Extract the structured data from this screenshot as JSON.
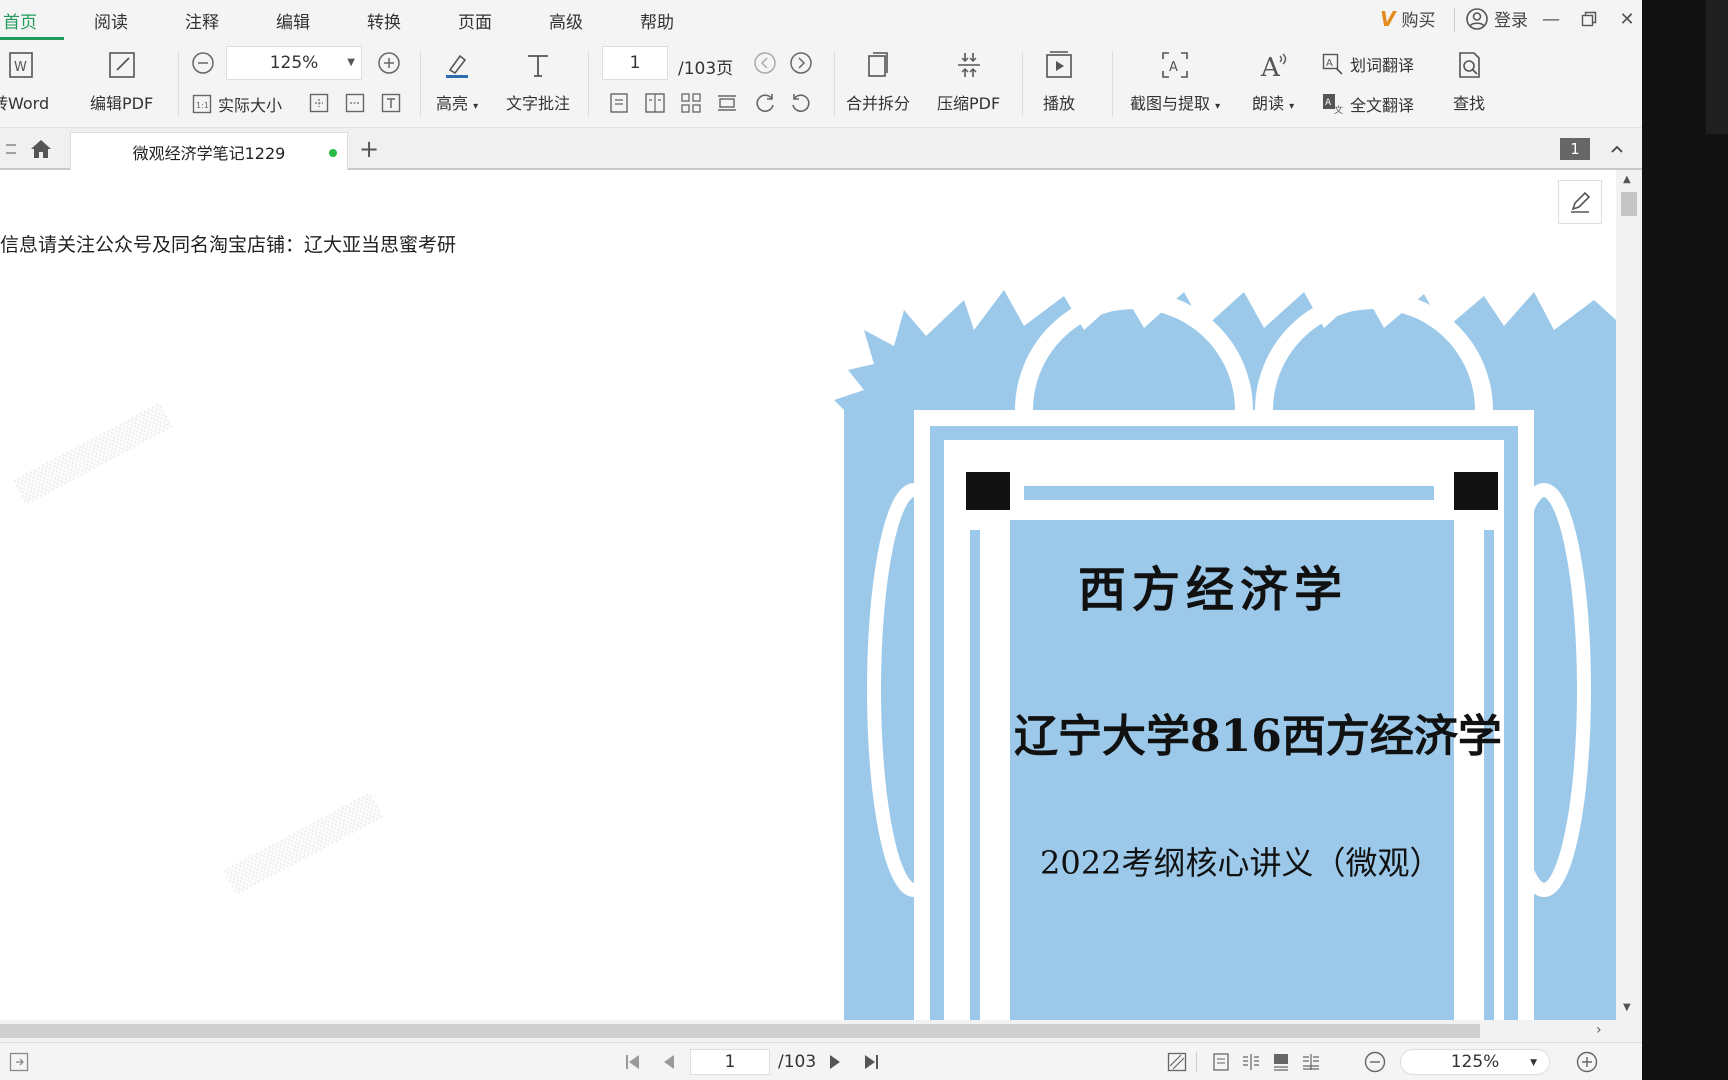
{
  "menu": {
    "items": [
      "首页",
      "阅读",
      "注释",
      "编辑",
      "转换",
      "页面",
      "高级",
      "帮助"
    ],
    "buy_label": "购买",
    "login_label": "登录"
  },
  "toolbar": {
    "to_word": "转Word",
    "edit_pdf": "编辑PDF",
    "zoom_value": "125%",
    "actual_size": "实际大小",
    "highlight": "高亮",
    "text_tool": "文字批注",
    "page_current": "1",
    "page_total": "/103页",
    "merge_split": "合并拆分",
    "compress_pdf": "压缩PDF",
    "play": "播放",
    "screenshot_extract": "截图与提取",
    "read_aloud": "朗读",
    "word_translate": "划词翻译",
    "full_translate": "全文翻译",
    "find": "查找"
  },
  "tabbar": {
    "doc_tab_title": "微观经济学笔记1229",
    "page_badge": "1"
  },
  "document": {
    "header_text": "信息请关注公众号及同名淘宝店铺：辽大亚当思蜜考研",
    "cover_title1": "西方经济学",
    "cover_title2": "辽宁大学816西方经济学",
    "cover_subtitle": "2022考纲核心讲义（微观）"
  },
  "statusbar": {
    "page_current": "1",
    "page_total": "/103",
    "zoom_value": "125%"
  },
  "colors": {
    "accent": "#1f9a5a",
    "cover_blue": "#9cc9ea",
    "cover_border": "#8fc3ea"
  }
}
